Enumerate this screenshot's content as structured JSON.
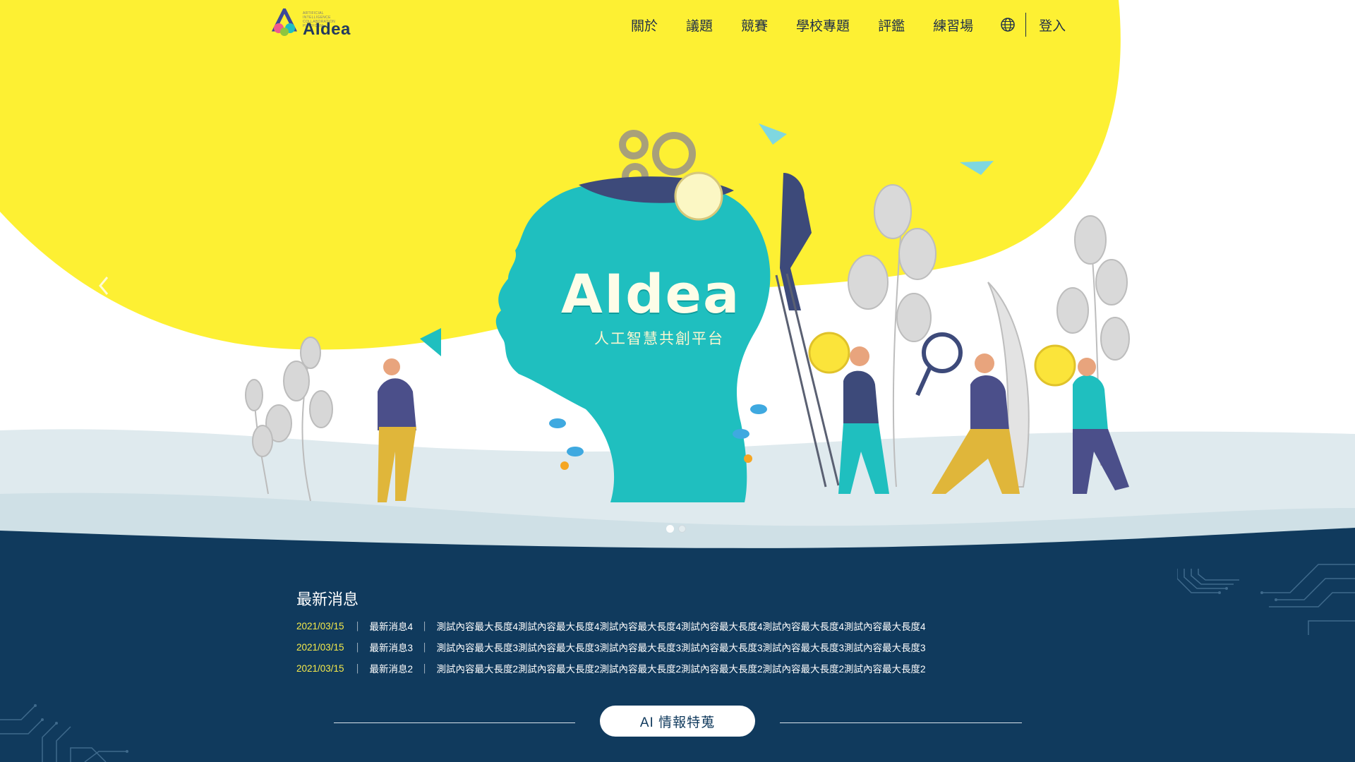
{
  "brand": {
    "logo_tagline": "ARTIFICIAL INTELLIGENCE COLLABORATION PLATFORM",
    "logo_word": "AIdea"
  },
  "nav": {
    "items": [
      "關於",
      "議題",
      "競賽",
      "學校專題",
      "評鑑",
      "練習場"
    ],
    "login": "登入"
  },
  "hero": {
    "title": "AIdea",
    "subtitle": "人工智慧共創平台",
    "slides_count": 2,
    "active_slide": 1
  },
  "news": {
    "heading": "最新消息",
    "items": [
      {
        "date": "2021/03/15",
        "title": "最新消息4",
        "body": "測試內容最大長度4測試內容最大長度4測試內容最大長度4測試內容最大長度4測試內容最大長度4測試內容最大長度4"
      },
      {
        "date": "2021/03/15",
        "title": "最新消息3",
        "body": "測試內容最大長度3測試內容最大長度3測試內容最大長度3測試內容最大長度3測試內容最大長度3測試內容最大長度3"
      },
      {
        "date": "2021/03/15",
        "title": "最新消息2",
        "body": "測試內容最大長度2測試內容最大長度2測試內容最大長度2測試內容最大長度2測試內容最大長度2測試內容最大長度2"
      }
    ],
    "separator": "｜"
  },
  "feature_button": "AI 情報特蒐",
  "colors": {
    "yellow": "#fbee34",
    "navy": "#103a5d",
    "teal": "#1fbfbf",
    "date_yellow": "#f5e94a"
  },
  "icons": [
    "globe-icon",
    "chevron-left-icon",
    "chevron-right-icon"
  ]
}
